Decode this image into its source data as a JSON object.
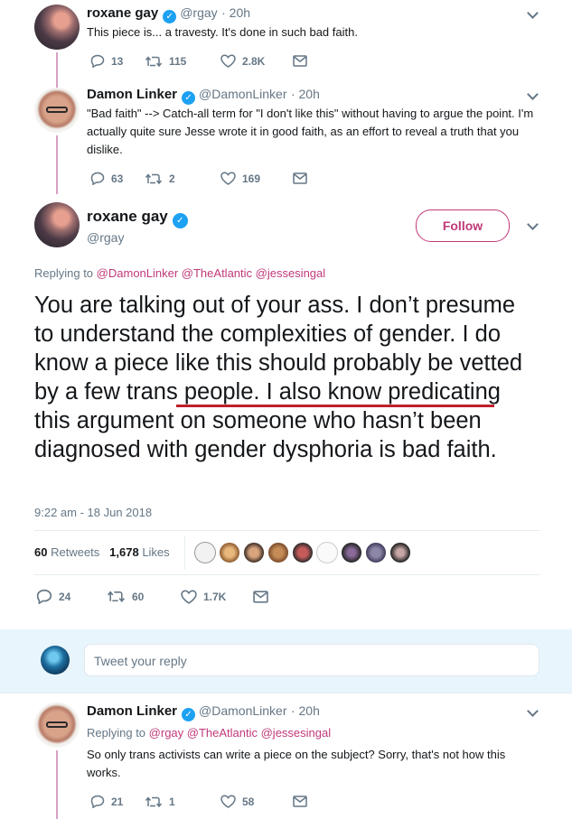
{
  "tweet1": {
    "name": "roxane gay",
    "handle": "@rgay",
    "time": "· 20h",
    "text": "This piece is... a travesty. It's done in such bad faith.",
    "replies": "13",
    "retweets": "115",
    "likes": "2.8K"
  },
  "tweet2": {
    "name": "Damon Linker",
    "handle": "@DamonLinker",
    "time": "· 20h",
    "text": "\"Bad faith\" --> Catch-all term for \"I don't like this\" without having to argue the point. I'm actually quite sure Jesse wrote it in good faith, as an effort to reveal a truth that you dislike.",
    "replies": "63",
    "retweets": "2",
    "likes": "169"
  },
  "main": {
    "name": "roxane gay",
    "handle": "@rgay",
    "follow_label": "Follow",
    "replying_to_prefix": "Replying to",
    "replying_to_mentions": "@DamonLinker @TheAtlantic @jessesingal",
    "text": "You are talking out of your ass. I don’t presume to understand the complexities of gender. I do know a piece like this should probably be vetted by a few trans people. I also know predicating this argument on someone who hasn’t been diagnosed with gender dysphoria is bad faith.",
    "timestamp": "9:22 am - 18 Jun 2018",
    "retweets_count": "60",
    "retweets_label": "Retweets",
    "likes_count": "1,678",
    "likes_label": "Likes",
    "replies": "24",
    "retweets": "60",
    "likes": "1.7K"
  },
  "reply_box": {
    "placeholder": "Tweet your reply"
  },
  "tweet3": {
    "name": "Damon Linker",
    "handle": "@DamonLinker",
    "time": "· 20h",
    "replying_to_prefix": "Replying to",
    "replying_to_mentions": "@rgay @TheAtlantic @jessesingal",
    "text": "So only trans activists can write a piece on the subject? Sorry, that's not how this works.",
    "replies": "21",
    "retweets": "1",
    "likes": "58"
  },
  "colors": {
    "accent": "#c0397a",
    "verified": "#1da1f2",
    "underline": "#c01f2c",
    "muted": "#657786"
  },
  "icons": [
    "reply-icon",
    "retweet-icon",
    "like-icon",
    "message-icon",
    "verified-icon",
    "chevron-down-icon"
  ]
}
